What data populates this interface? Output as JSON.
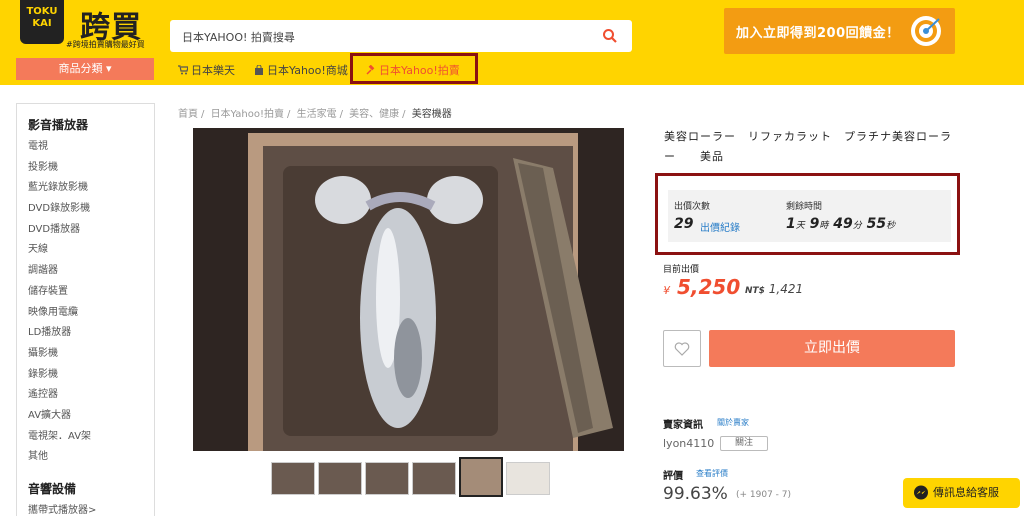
{
  "logo": {
    "line1": "TOKU",
    "line2": "KAI",
    "brand": "跨買",
    "tagline": "#跨境拍賣購物最好買"
  },
  "search": {
    "placeholder": "日本YAHOO! 拍賣搜尋"
  },
  "promo": {
    "text": "加入立即得到200回饋金！"
  },
  "nav": {
    "category_button": "商品分類",
    "items": [
      {
        "label": "日本樂天",
        "icon": "cart-icon"
      },
      {
        "label": "日本Yahoo!商城",
        "icon": "bag-icon"
      },
      {
        "label": "日本Yahoo!拍賣",
        "icon": "gavel-icon"
      }
    ]
  },
  "sidebar": {
    "section1": "影音播放器",
    "items": [
      "電視",
      "投影機",
      "藍光錄放影機",
      "DVD錄放影機",
      "DVD播放器",
      "天線",
      "調諧器",
      "儲存裝置",
      "映像用電纜",
      "LD播放器",
      "攝影機",
      "錄影機",
      "遙控器",
      "AV擴大器",
      "電視架．AV架",
      "其他"
    ],
    "section2": "音響設備",
    "items2": [
      "攜帶式播放器>"
    ]
  },
  "breadcrumb": [
    "首頁",
    "日本Yahoo!拍賣",
    "生活家電",
    "美容、健康",
    "美容機器"
  ],
  "product": {
    "title": "美容ローラー　リファカラット　プラチナ美容ローラー　　美品"
  },
  "auction": {
    "bids_label": "出價次數",
    "bids": "29",
    "bid_history": "出價紀錄",
    "remaining_label": "剩餘時間",
    "d": "1",
    "d_u": "天",
    "h": "9",
    "h_u": "時",
    "m": "49",
    "m_u": "分",
    "s": "55",
    "s_u": "秒"
  },
  "price": {
    "label": "目前出價",
    "yen_symbol": "¥",
    "yen": "5,250",
    "ntd_prefix": "NT$",
    "ntd": "1,421"
  },
  "actions": {
    "bid": "立即出價"
  },
  "seller": {
    "label": "賣家資訊",
    "about": "關於賣家",
    "name": "lyon4110",
    "follow": "關注"
  },
  "rating": {
    "label": "評價",
    "link": "查看評價",
    "percent": "99.63%",
    "counts": "(+ 1907 - 7)"
  },
  "messenger": {
    "label": "傳訊息給客服"
  }
}
